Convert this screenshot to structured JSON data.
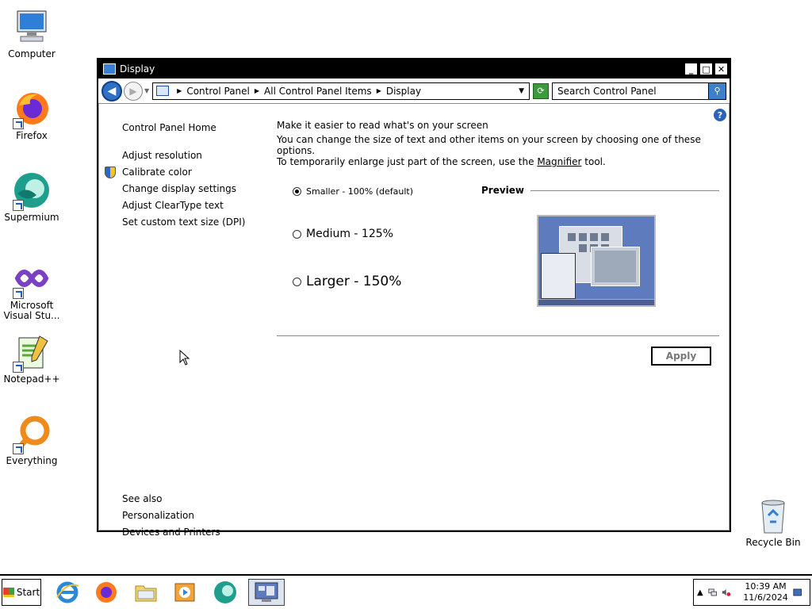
{
  "desktop": {
    "icons": [
      {
        "label": "Computer"
      },
      {
        "label": "Firefox"
      },
      {
        "label": "Supermium"
      },
      {
        "label": "Microsoft Visual Stu..."
      },
      {
        "label": "Notepad++"
      },
      {
        "label": "Everything"
      },
      {
        "label": "Recycle Bin"
      }
    ]
  },
  "window": {
    "title": "Display",
    "controls": {
      "minimize": "_",
      "maximize": "□",
      "close": "✕"
    },
    "breadcrumb": [
      "Control Panel",
      "All Control Panel Items",
      "Display"
    ],
    "search": {
      "placeholder": "Search Control Panel"
    },
    "help": "?"
  },
  "left_nav": {
    "home": "Control Panel Home",
    "links": [
      "Adjust resolution",
      "Calibrate color",
      "Change display settings",
      "Adjust ClearType text",
      "Set custom text size (DPI)"
    ],
    "see_also": {
      "heading": "See also",
      "links": [
        "Personalization",
        "Devices and Printers"
      ]
    }
  },
  "main": {
    "heading": "Make it easier to read what's on your screen",
    "desc_line1": "You can change the size of text and other items on your screen by choosing one of these options.",
    "desc_line2_pre": "To temporarily enlarge just part of the screen, use the ",
    "desc_link": "Magnifier",
    "desc_line2_post": " tool.",
    "options": [
      {
        "label": "Smaller - 100% (default)",
        "selected": true
      },
      {
        "label": "Medium - 125%",
        "selected": false
      },
      {
        "label": "Larger - 150%",
        "selected": false
      }
    ],
    "preview_label": "Preview",
    "apply_label": "Apply"
  },
  "taskbar": {
    "start_label": "Start",
    "apps": [
      "internet-explorer",
      "firefox",
      "file-explorer",
      "media-player",
      "supermium",
      "control-panel-display"
    ],
    "clock": {
      "time": "10:39 AM",
      "date": "11/6/2024"
    }
  },
  "colors": {
    "titlebar": "#000000",
    "accent": "#2f6fc4"
  }
}
